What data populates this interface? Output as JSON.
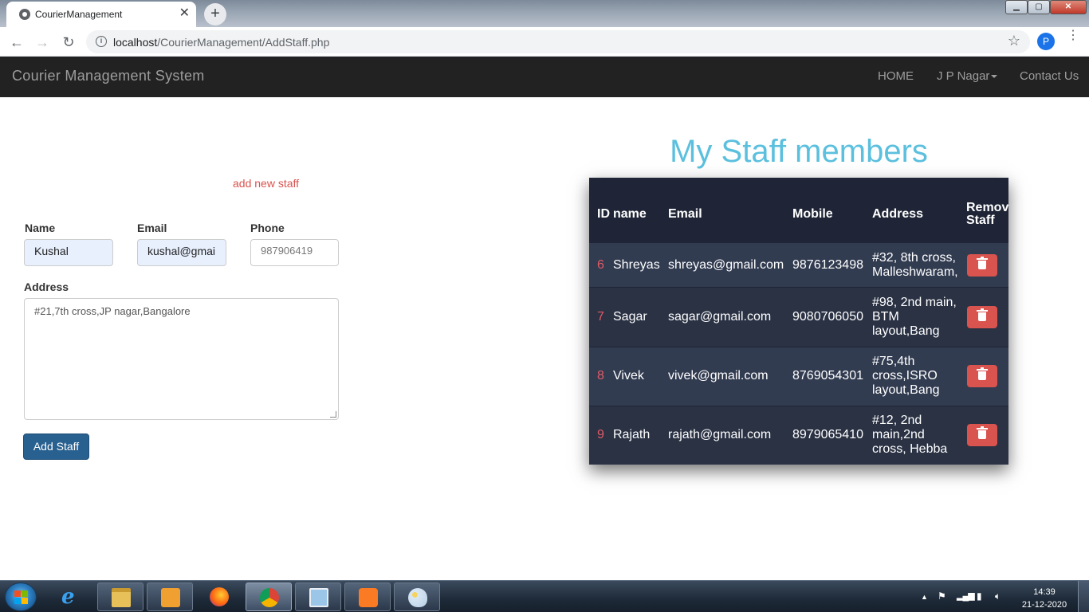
{
  "browser": {
    "tab_title": "CourierManagement",
    "tab_close": "✕",
    "new_tab": "+",
    "url_host": "localhost",
    "url_path": "/CourierManagement/AddStaff.php",
    "profile_initial": "P",
    "back": "←",
    "forward": "→",
    "reload": "↻",
    "info": "i",
    "star": "☆",
    "menu": "⋮"
  },
  "window_controls": {
    "minimize": "▁",
    "maximize": "▢",
    "close": "✕"
  },
  "navbar": {
    "brand": "Courier Management System",
    "home": "HOME",
    "branch": "J P Nagar",
    "contact": "Contact Us"
  },
  "form": {
    "add_new_staff_link": "add new staff",
    "name_label": "Name",
    "name_value": "Kushal",
    "email_label": "Email",
    "email_value": "kushal@gmai",
    "phone_label": "Phone",
    "phone_value": "987906419",
    "address_label": "Address",
    "address_value": "#21,7th cross,JP nagar,Bangalore",
    "submit": "Add Staff"
  },
  "staff": {
    "heading": "My Staff members",
    "headers": {
      "id": "ID",
      "name": "name",
      "email": "Email",
      "mobile": "Mobile",
      "address": "Address",
      "remove_line1": "Remov",
      "remove_line2": "Staff"
    },
    "rows": [
      {
        "id": "6",
        "name": "Shreyas",
        "email": "shreyas@gmail.com",
        "mobile": "9876123498",
        "address_lines": [
          "#32, 8th cross,",
          "Malleshwaram,",
          ""
        ]
      },
      {
        "id": "7",
        "name": "Sagar",
        "email": "sagar@gmail.com",
        "mobile": "9080706050",
        "address_lines": [
          "#98, 2nd main,",
          "BTM",
          "layout,Bang"
        ]
      },
      {
        "id": "8",
        "name": "Vivek",
        "email": "vivek@gmail.com",
        "mobile": "8769054301",
        "address_lines": [
          "#75,4th",
          "cross,ISRO",
          "layout,Bang"
        ]
      },
      {
        "id": "9",
        "name": "Rajath",
        "email": "rajath@gmail.com",
        "mobile": "8979065410",
        "address_lines": [
          "#12, 2nd",
          "main,2nd",
          "cross, Hebba"
        ]
      }
    ]
  },
  "taskbar": {
    "apps": [
      "internet-explorer",
      "file-explorer",
      "media-player",
      "firefox",
      "chrome",
      "control-panel",
      "xampp",
      "paint"
    ],
    "time": "14:39",
    "date": "21-12-2020"
  },
  "colors": {
    "navbar_bg": "#222222",
    "heading": "#5bc0de",
    "link_red": "#d9534f",
    "btn_primary": "#286090",
    "table_bg": "#2c3445",
    "table_head": "#1f2536",
    "id_red": "#e05a66",
    "delete_btn": "#d9534f"
  }
}
